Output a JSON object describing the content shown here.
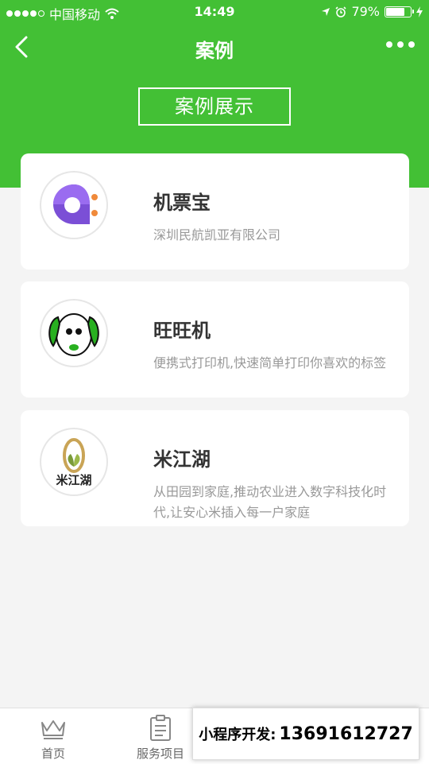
{
  "status_bar": {
    "carrier": "中国移动",
    "time": "14:49",
    "battery": "79%",
    "battery_level": 0.79
  },
  "nav": {
    "title": "案例",
    "back_icon": "chevron-left-icon",
    "more_icon": "more-dots-icon"
  },
  "section_title": "案例展示",
  "cases": [
    {
      "name": "机票宝",
      "desc": "深圳民航凯亚有限公司",
      "logo": "ticket-logo"
    },
    {
      "name": "旺旺机",
      "desc": "便携式打印机,快速简单打印你喜欢的标签",
      "logo": "dog-logo"
    },
    {
      "name": "米江湖",
      "desc": "从田园到家庭,推动农业进入数字科技化时代,让安心米插入每一户家庭",
      "logo": "rice-logo",
      "logo_text": "米江湖"
    }
  ],
  "tabbar": {
    "tabs": [
      {
        "label": "首页",
        "icon": "crown-icon"
      },
      {
        "label": "服务项目",
        "icon": "clipboard-icon"
      }
    ]
  },
  "contact": {
    "label": "小程序开发:",
    "phone": "13691612727"
  },
  "colors": {
    "brand_green": "#43c035",
    "background": "#f4f4f4"
  }
}
